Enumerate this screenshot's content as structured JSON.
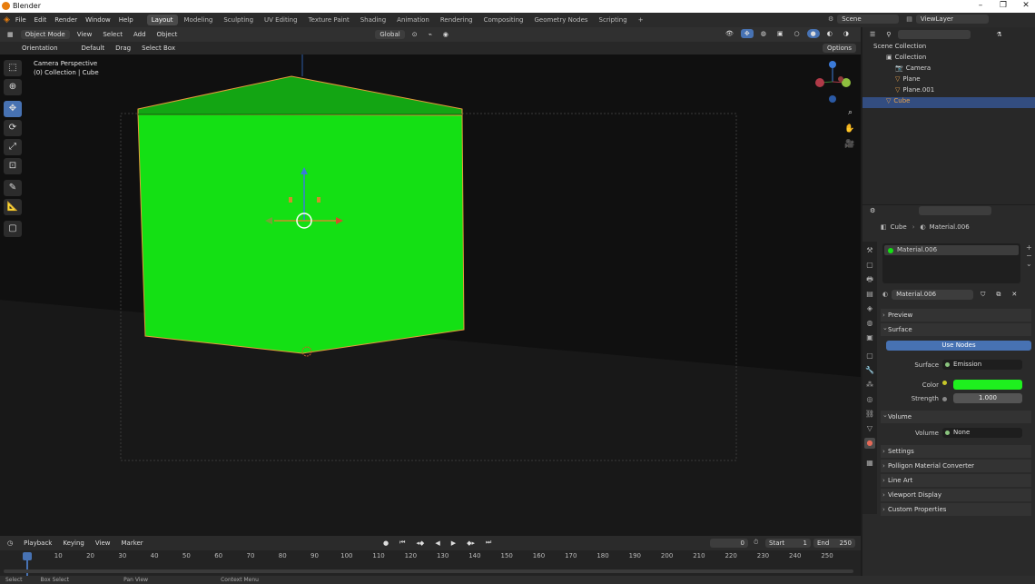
{
  "window": {
    "title": "Blender"
  },
  "menu": [
    "File",
    "Edit",
    "Render",
    "Window",
    "Help"
  ],
  "workspaces": [
    "Layout",
    "Modeling",
    "Sculpting",
    "UV Editing",
    "Texture Paint",
    "Shading",
    "Animation",
    "Rendering",
    "Compositing",
    "Geometry Nodes",
    "Scripting"
  ],
  "workspace_add": "+",
  "scene": {
    "label": "Scene",
    "view_layer": "ViewLayer"
  },
  "header": {
    "mode": "Object Mode",
    "view": "View",
    "select": "Select",
    "add": "Add",
    "object": "Object",
    "transform": "Global"
  },
  "tool_settings": {
    "orientation_label": "Orientation",
    "orientation_value": "Default",
    "drag_label": "Drag",
    "drag_value": "Select Box",
    "options": "Options"
  },
  "viewport": {
    "line1": "Camera Perspective",
    "line2": "(0) Collection | Cube",
    "colors": {
      "cube": "#14e014",
      "cube_top": "#13a513",
      "outline": "#e89a3c",
      "bg": "#141414"
    }
  },
  "outliner": {
    "search_placeholder": "",
    "root": "Scene Collection",
    "items": [
      {
        "name": "Collection",
        "icon": "collection-icon"
      },
      {
        "name": "Camera",
        "icon": "camera-icon"
      },
      {
        "name": "Plane",
        "icon": "mesh-icon"
      },
      {
        "name": "Plane.001",
        "icon": "mesh-icon"
      },
      {
        "name": "Cube",
        "icon": "mesh-icon"
      }
    ]
  },
  "properties": {
    "breadcrumb_object": "Cube",
    "breadcrumb_material": "Material.006",
    "slot_name": "Material.006",
    "material_name": "Material.006",
    "panels": {
      "preview": "Preview",
      "surface": "Surface",
      "use_nodes": "Use Nodes",
      "surface_label": "Surface",
      "surface_value": "Emission",
      "color_label": "Color",
      "color_value": "#1ef01e",
      "strength_label": "Strength",
      "strength_value": "1.000",
      "volume": "Volume",
      "volume_label": "Volume",
      "volume_value": "None",
      "settings": "Settings",
      "polygon_converter": "Polligon Material Converter",
      "line_art": "Line Art",
      "viewport_display": "Viewport Display",
      "custom_properties": "Custom Properties"
    }
  },
  "timeline": {
    "playback": "Playback",
    "keying": "Keying",
    "view": "View",
    "marker": "Marker",
    "current_frame": "0",
    "start_label": "Start",
    "start": "1",
    "end_label": "End",
    "end": "250",
    "ticks": [
      "0",
      "10",
      "20",
      "30",
      "40",
      "50",
      "60",
      "70",
      "80",
      "90",
      "100",
      "110",
      "120",
      "130",
      "140",
      "150",
      "160",
      "170",
      "180",
      "190",
      "200",
      "210",
      "220",
      "230",
      "240",
      "250"
    ]
  },
  "status": {
    "select": "Select",
    "box_select": "Box Select",
    "pan_view": "Pan View",
    "context_menu": "Context Menu"
  }
}
